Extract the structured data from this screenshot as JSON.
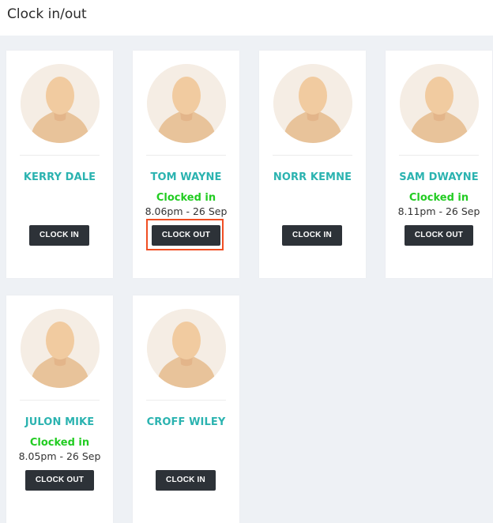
{
  "header": {
    "title": "Clock in/out"
  },
  "employees": [
    {
      "name": "KERRY DALE",
      "status": "",
      "time": "",
      "button": "CLOCK IN"
    },
    {
      "name": "TOM WAYNE",
      "status": "Clocked in",
      "time": "8.06pm - 26 Sep",
      "button": "CLOCK OUT"
    },
    {
      "name": "NORR KEMNE",
      "status": "",
      "time": "",
      "button": "CLOCK IN"
    },
    {
      "name": "SAM DWAYNE",
      "status": "Clocked in",
      "time": "8.11pm - 26 Sep",
      "button": "CLOCK OUT"
    },
    {
      "name": "JULON MIKE",
      "status": "Clocked in",
      "time": "8.05pm - 26 Sep",
      "button": "CLOCK OUT"
    },
    {
      "name": "CROFF WILEY",
      "status": "",
      "time": "",
      "button": "CLOCK IN"
    }
  ],
  "colors": {
    "accent_name": "#2bb3b0",
    "status_green": "#22cc22",
    "button_dark": "#2d3238",
    "highlight": "#f04e23",
    "background": "#eef1f5"
  },
  "icons": {
    "avatar": "default-user-silhouette"
  }
}
